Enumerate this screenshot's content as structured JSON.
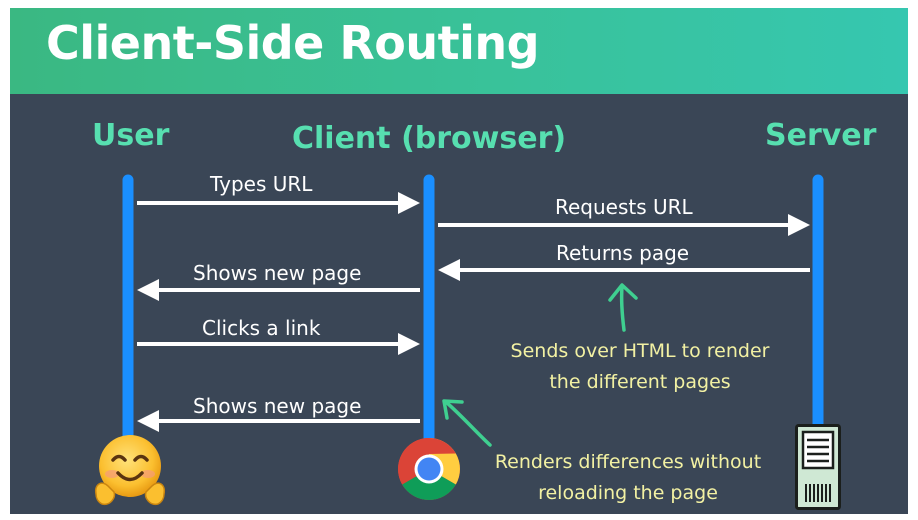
{
  "title": "Client-Side Routing",
  "lanes": {
    "user": "User",
    "client": "Client (browser)",
    "server": "Server"
  },
  "messages": {
    "types_url": "Types URL",
    "requests_url": "Requests URL",
    "returns_page": "Returns page",
    "shows_new_page_1": "Shows new page",
    "clicks_link": "Clicks a link",
    "shows_new_page_2": "Shows new page"
  },
  "notes": {
    "server_note_line1": "Sends over HTML to render",
    "server_note_line2": "the different pages",
    "client_note_line1": "Renders differences without",
    "client_note_line2": "reloading the page"
  },
  "icons": {
    "user": "smiling-face-with-open-hands-emoji",
    "client": "chrome-browser-icon",
    "server": "server-rack-icon"
  },
  "colors": {
    "background": "#3a4656",
    "title_bar": "#3abf90",
    "lane_heading": "#57dfb0",
    "lifeline": "#1a8fff",
    "arrow": "#ffffff",
    "note_text": "#f2f1a3",
    "note_arrow": "#3fcf90"
  }
}
